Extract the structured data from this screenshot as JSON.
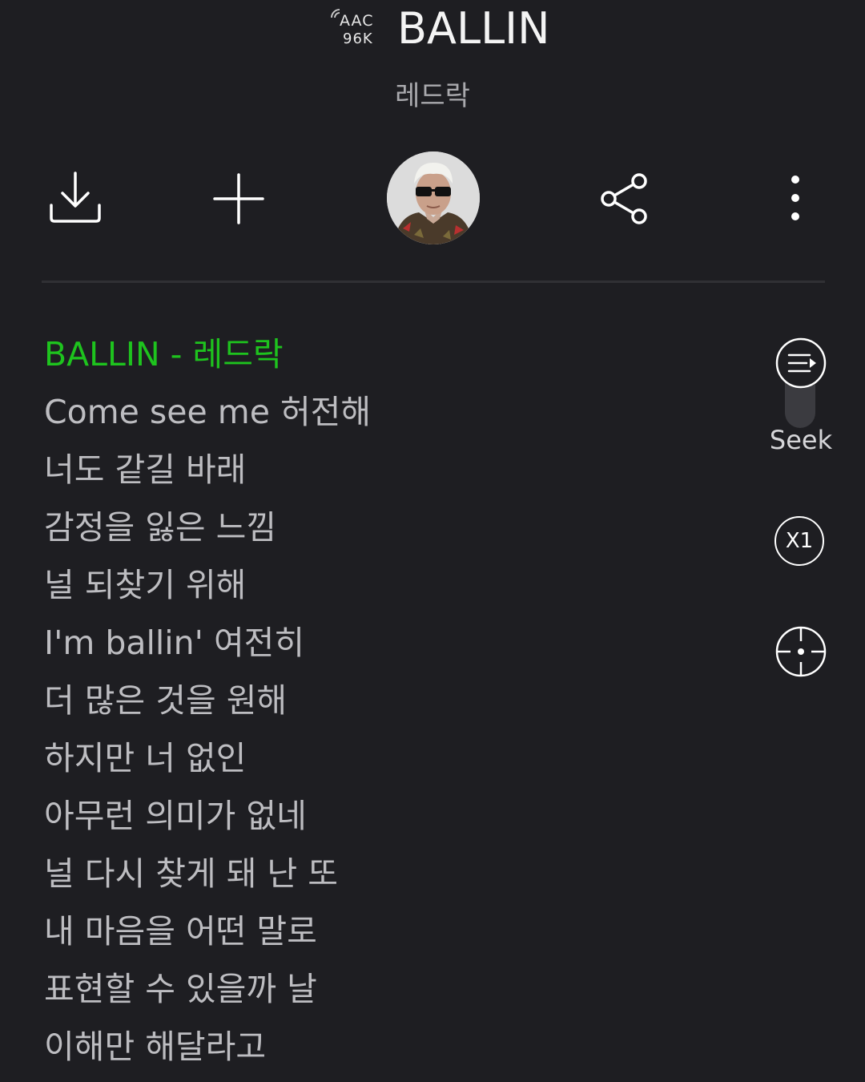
{
  "header": {
    "quality_codec": "AAC",
    "quality_bitrate": "96K",
    "title": "BALLIN",
    "artist": "레드락"
  },
  "toolbar": {
    "download_icon": "download-icon",
    "add_icon": "plus-icon",
    "share_icon": "share-icon",
    "more_icon": "more-vertical-icon"
  },
  "lyrics": {
    "current_line": "BALLIN - 레드락",
    "lines": [
      "Come see me 허전해",
      "너도 같길 바래",
      "감정을 잃은 느낌",
      "널 되찾기 위해",
      "I'm ballin' 여전히",
      "더 많은 것을 원해",
      "하지만 너 없인",
      "아무런 의미가 없네",
      "널 다시 찾게 돼 난 또",
      "내 마음을 어떤 말로",
      "표현할 수 있을까 날",
      "이해만 해달라고"
    ]
  },
  "side_controls": {
    "seek_label": "Seek",
    "speed_label": "X1",
    "seek_icon": "lyrics-scroll-icon",
    "locate_icon": "crosshair-icon"
  },
  "colors": {
    "background": "#1e1e22",
    "accent_green": "#1ec31e",
    "lyric_text": "#bdbdc1"
  }
}
